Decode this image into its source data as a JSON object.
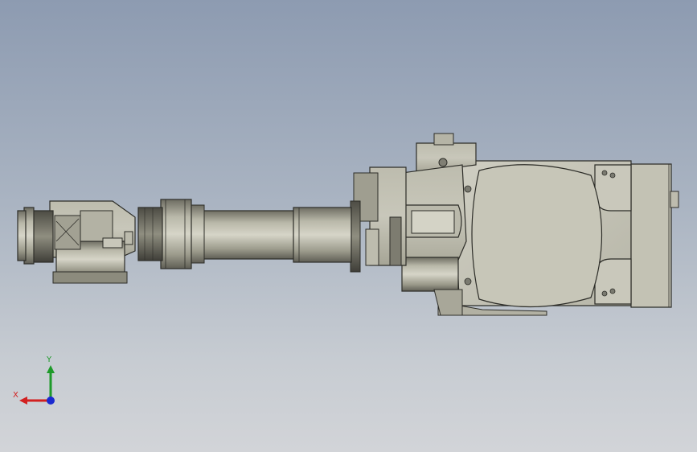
{
  "viewport": {
    "background_top": "#8d9bb1",
    "background_bottom": "#d2d4d8",
    "model": "robot-arm-assembly"
  },
  "triad": {
    "x_label": "X",
    "y_label": "Y",
    "x_color": "#d22020",
    "y_color": "#1e9a2a",
    "z_color": "#1a2ad0"
  }
}
